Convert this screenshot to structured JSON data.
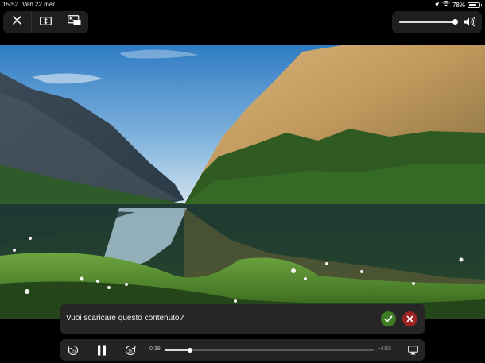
{
  "status_bar": {
    "time": "15:52",
    "date": "Ven 22 mar",
    "battery_percent": "78%",
    "battery_level": 0.78
  },
  "top_controls": {
    "icons": [
      "close-icon",
      "aspect-ratio-icon",
      "picture-in-picture-icon"
    ]
  },
  "volume": {
    "level": 0.98,
    "icon": "speaker-icon"
  },
  "prompt": {
    "text": "Vuoi scaricare questo contenuto?",
    "confirm_icon": "checkmark-icon",
    "cancel_icon": "x-icon",
    "confirm_color": "#3f7d24",
    "cancel_color": "#9a2222"
  },
  "playback": {
    "elapsed": "0:39",
    "remaining": "-4:53",
    "progress": 0.12,
    "skip_back_label": "15",
    "skip_forward_label": "15"
  }
}
